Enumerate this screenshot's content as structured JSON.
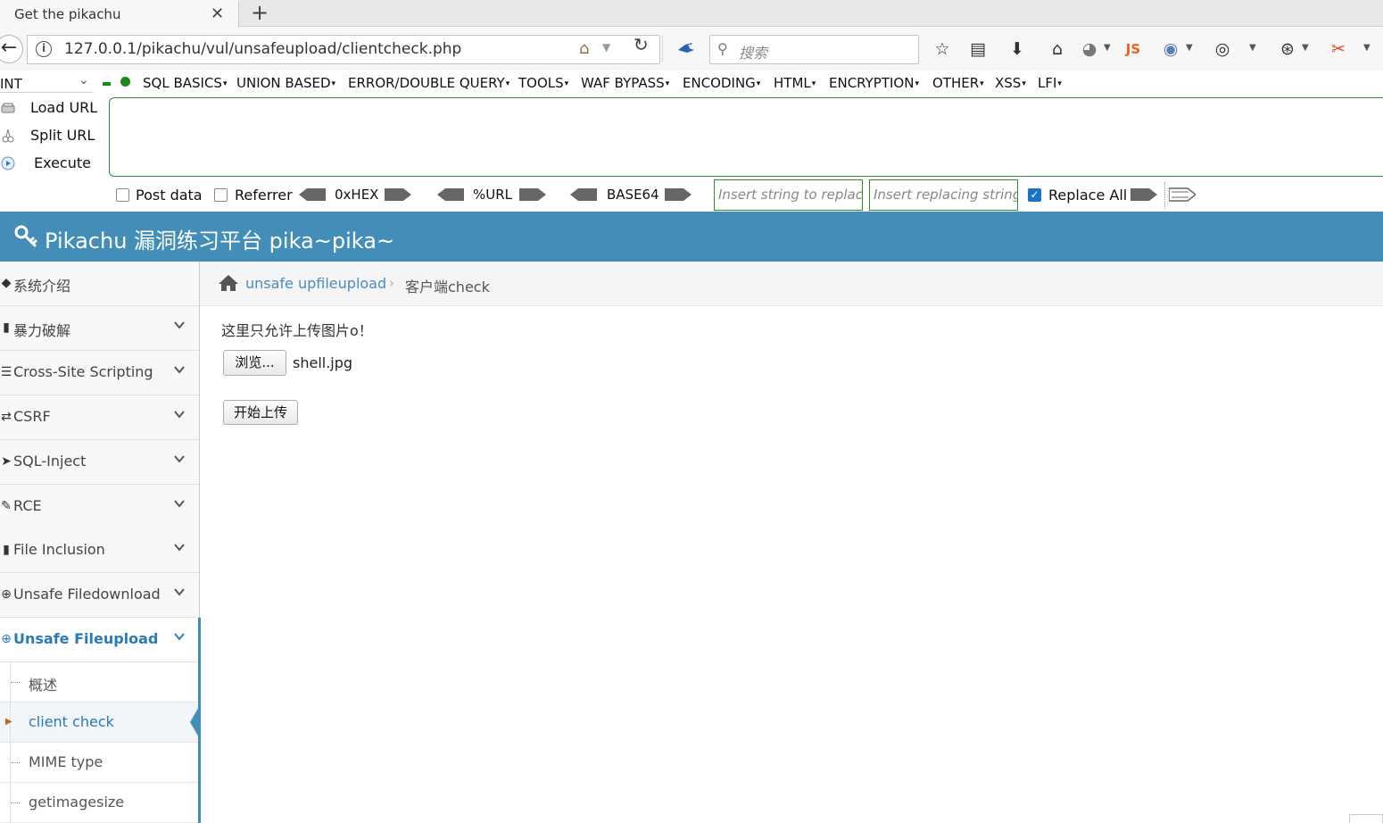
{
  "browser": {
    "tab_title": "Get the pikachu",
    "close_glyph": "✕",
    "new_tab_glyph": "+",
    "url": "127.0.0.1/pikachu/vul/unsafeupload/clientcheck.php",
    "search_placeholder": "搜索",
    "toolbar_icons": [
      "star-icon",
      "reading-list-icon",
      "download-icon",
      "home-icon",
      "globe-icon",
      "js-icon",
      "colorzilla-icon",
      "palette-icon",
      "world-icon",
      "scissors-icon",
      "overflow-icon"
    ],
    "js_label": "JS"
  },
  "hackbar": {
    "select_value": "INT",
    "menus": [
      {
        "label": "SQL BASICS"
      },
      {
        "label": "UNION BASED"
      },
      {
        "label": "ERROR/DOUBLE QUERY"
      },
      {
        "label": "TOOLS"
      },
      {
        "label": "WAF BYPASS"
      },
      {
        "label": "ENCODING"
      },
      {
        "label": "HTML"
      },
      {
        "label": "ENCRYPTION"
      },
      {
        "label": "OTHER"
      },
      {
        "label": "XSS"
      },
      {
        "label": "LFI"
      }
    ],
    "actions": {
      "load_url": "Load URL",
      "split_url": "Split URL",
      "execute": "Execute"
    },
    "post_data": {
      "label": "Post data",
      "checked": false
    },
    "referrer": {
      "label": "Referrer",
      "checked": false
    },
    "encoders": {
      "hex": "0xHEX",
      "url": "%URL",
      "base64": "BASE64"
    },
    "replace_placeholder": "Insert string to replace",
    "replacing_placeholder": "Insert replacing string",
    "replace_all": {
      "label": "Replace All",
      "checked": true
    }
  },
  "site": {
    "title": "Pikachu 漏洞练习平台 pika~pika~",
    "header_color": "#438eb9"
  },
  "sidebar": {
    "items": [
      {
        "label": "系统介绍",
        "icon": "tag-icon",
        "expandable": false
      },
      {
        "label": "暴力破解",
        "icon": "lock-icon",
        "expandable": true
      },
      {
        "label": "Cross-Site Scripting",
        "icon": "list-icon",
        "expandable": true
      },
      {
        "label": "CSRF",
        "icon": "share-icon",
        "expandable": true
      },
      {
        "label": "SQL-Inject",
        "icon": "fighter-jet-icon",
        "expandable": true
      },
      {
        "label": "RCE",
        "icon": "pencil-icon",
        "expandable": true
      },
      {
        "label": "File Inclusion",
        "icon": "file-icon",
        "expandable": true
      },
      {
        "label": "Unsafe Filedownload",
        "icon": "download-circle-icon",
        "expandable": true
      },
      {
        "label": "Unsafe Fileupload",
        "icon": "upload-circle-icon",
        "expandable": true,
        "active": true
      }
    ],
    "subitems": [
      {
        "label": "概述"
      },
      {
        "label": "client check",
        "active": true
      },
      {
        "label": "MIME type"
      },
      {
        "label": "getimagesize"
      }
    ]
  },
  "breadcrumb": {
    "link": "unsafe upfileupload",
    "separator": "›",
    "current": "客户端check"
  },
  "main": {
    "hint": "这里只允许上传图片o！",
    "browse_label": "浏览...",
    "file_name": "shell.jpg",
    "upload_label": "开始上传"
  }
}
